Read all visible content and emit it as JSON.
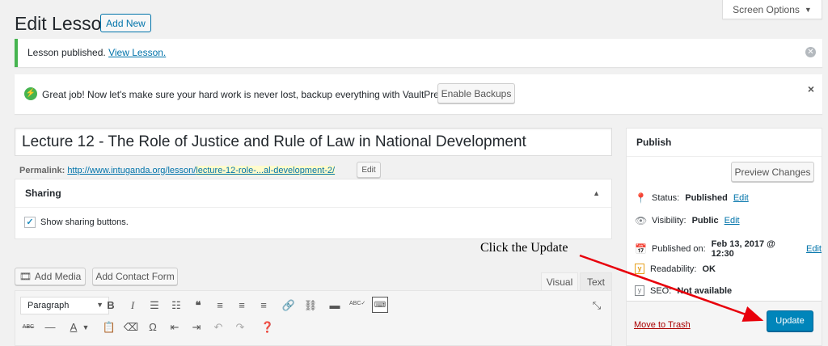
{
  "header": {
    "title": "Edit Lesson",
    "add_new": "Add New",
    "screen_options": "Screen Options",
    "screen_options_arrow": "▼"
  },
  "notices": {
    "published_text": "Lesson published.",
    "published_link": "View Lesson.",
    "dismiss": "✕",
    "vaultpress_text": "Great job! Now let's make sure your hard work is never lost, backup everything with VaultPress.",
    "vaultpress_button": "Enable Backups",
    "close": "×"
  },
  "post": {
    "title": "Lecture 12 - The Role of Justice and Rule of Law in National Development",
    "permalink_label": "Permalink:",
    "permalink_base": "http://www.intuganda.org/lesson/",
    "permalink_slug": "lecture-12-role-...al-development-2/",
    "permalink_edit": "Edit"
  },
  "sharing": {
    "title": "Sharing",
    "checkbox_label": "Show sharing buttons.",
    "checked": true
  },
  "editor": {
    "add_media": "Add Media",
    "add_contact_form": "Add Contact Form",
    "tab_visual": "Visual",
    "tab_text": "Text",
    "format_select": "Paragraph",
    "toolbar_row1": [
      "bold-icon",
      "italic-icon",
      "bullet-list-icon",
      "numbered-list-icon",
      "blockquote-icon",
      "align-left-icon",
      "align-center-icon",
      "align-right-icon",
      "link-icon",
      "unlink-icon",
      "read-more-icon",
      "spellcheck-icon",
      "toolbar-toggle-icon"
    ],
    "toolbar_row2": [
      "strikethrough-icon",
      "horizontal-line-icon",
      "text-color-icon",
      "paste-text-icon",
      "clear-formatting-icon",
      "special-character-icon",
      "outdent-icon",
      "indent-icon",
      "undo-icon",
      "redo-icon",
      "help-icon"
    ]
  },
  "publish": {
    "title": "Publish",
    "preview": "Preview Changes",
    "status_label": "Status:",
    "status_value": "Published",
    "visibility_label": "Visibility:",
    "visibility_value": "Public",
    "published_on_label": "Published on:",
    "published_on_value": "Feb 13, 2017 @ 12:30",
    "edit": "Edit",
    "readability_label": "Readability:",
    "readability_value": "OK",
    "seo_label": "SEO:",
    "seo_value": "Not available",
    "trash": "Move to Trash",
    "update": "Update"
  },
  "annotation": {
    "text": "Click the Update",
    "color": "#e8000b"
  },
  "colors": {
    "accent": "#0073aa",
    "primary_button": "#0085ba",
    "success": "#46b450",
    "trash": "#a00"
  }
}
